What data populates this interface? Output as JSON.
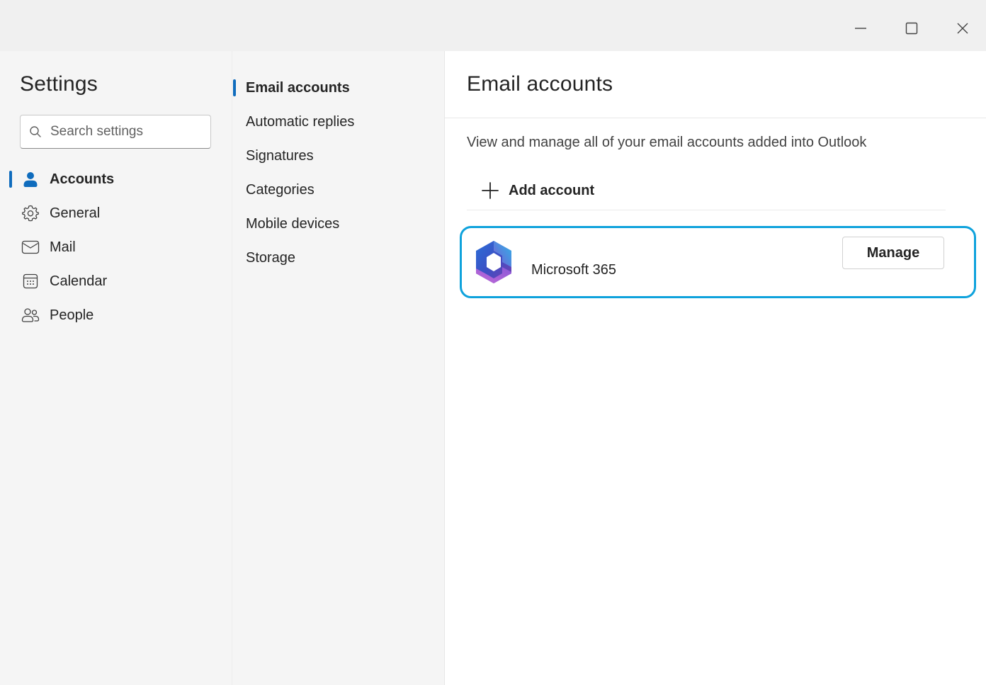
{
  "window": {
    "controls": {
      "minimize_icon": "minimize-icon",
      "maximize_icon": "maximize-icon",
      "close_icon": "close-icon"
    }
  },
  "sidebar": {
    "title": "Settings",
    "search": {
      "placeholder": "Search settings",
      "value": ""
    },
    "items": [
      {
        "label": "Accounts",
        "icon": "person-icon",
        "active": true
      },
      {
        "label": "General",
        "icon": "gear-icon",
        "active": false
      },
      {
        "label": "Mail",
        "icon": "mail-icon",
        "active": false
      },
      {
        "label": "Calendar",
        "icon": "calendar-icon",
        "active": false
      },
      {
        "label": "People",
        "icon": "people-icon",
        "active": false
      }
    ]
  },
  "subnav": {
    "items": [
      {
        "label": "Email accounts",
        "active": true
      },
      {
        "label": "Automatic replies",
        "active": false
      },
      {
        "label": "Signatures",
        "active": false
      },
      {
        "label": "Categories",
        "active": false
      },
      {
        "label": "Mobile devices",
        "active": false
      },
      {
        "label": "Storage",
        "active": false
      }
    ]
  },
  "main": {
    "title": "Email accounts",
    "description": "View and manage all of your email accounts added into Outlook",
    "add_account_label": "Add account",
    "accounts": [
      {
        "name": "Microsoft 365",
        "logo": "microsoft-365-logo",
        "manage_label": "Manage"
      }
    ]
  },
  "colors": {
    "accent": "#0f6cbd",
    "highlight_border": "#0ea2dc",
    "sidebar_bg": "#f5f5f5",
    "titlebar_bg": "#f0f0f0",
    "content_bg": "#ffffff"
  }
}
